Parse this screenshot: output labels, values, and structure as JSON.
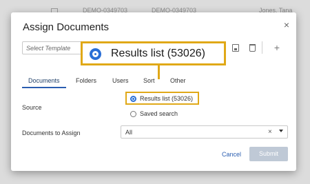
{
  "background": {
    "row": [
      "DEMO-0349703",
      "DEMO-0349703",
      "Jones, Tana"
    ]
  },
  "dialog": {
    "title": "Assign Documents",
    "close": "×",
    "template_placeholder": "Select Template",
    "tabs": [
      "Documents",
      "Folders",
      "Users",
      "Sort",
      "Other"
    ],
    "active_tab": "Documents",
    "source_label": "Source",
    "source_options": [
      {
        "label": "Results list (53026)",
        "selected": true
      },
      {
        "label": "Saved search",
        "selected": false
      }
    ],
    "docs_label": "Documents to Assign",
    "docs_value": "All",
    "docs_clear": "×",
    "cancel": "Cancel",
    "submit": "Submit",
    "plus": "+"
  },
  "callout": {
    "text": "Results list (53026)"
  },
  "colors": {
    "accent": "#2a6fd6",
    "highlight": "#e0a817",
    "submit_disabled": "#bfc9d6"
  },
  "icons": [
    "envelope-icon",
    "save-icon",
    "trash-icon",
    "plus-icon",
    "close-icon",
    "chevron-down-icon"
  ]
}
